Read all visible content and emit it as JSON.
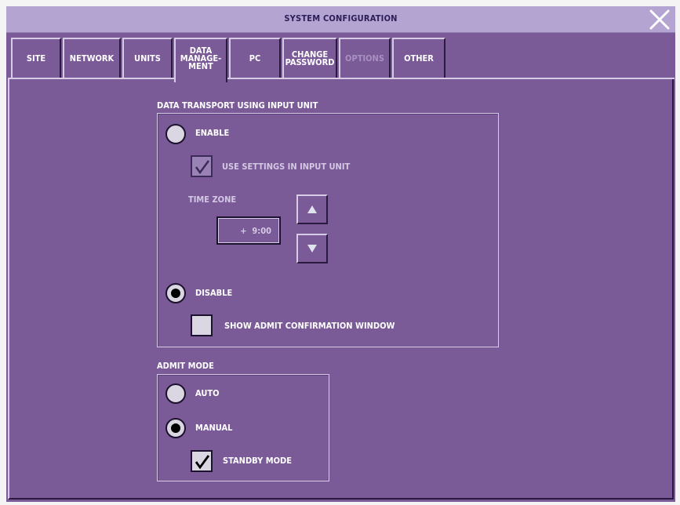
{
  "window": {
    "title": "SYSTEM CONFIGURATION"
  },
  "tabs": [
    {
      "label": [
        "SITE"
      ]
    },
    {
      "label": [
        "NETWORK"
      ]
    },
    {
      "label": [
        "UNITS"
      ]
    },
    {
      "label": [
        "DATA",
        "MANAGE-",
        "MENT"
      ],
      "active": true
    },
    {
      "label": [
        "PC"
      ]
    },
    {
      "label": [
        "CHANGE",
        "PASSWORD"
      ]
    },
    {
      "label": [
        "OPTIONS"
      ],
      "disabled": true
    },
    {
      "label": [
        "OTHER"
      ]
    }
  ],
  "tab_labels": {
    "site": "SITE",
    "network": "NETWORK",
    "units": "UNITS",
    "data_1": "DATA",
    "data_2": "MANAGE-",
    "data_3": "MENT",
    "pc": "PC",
    "change_1": "CHANGE",
    "change_2": "PASSWORD",
    "options": "OPTIONS",
    "other": "OTHER"
  },
  "data_transport": {
    "label": "DATA TRANSPORT USING INPUT UNIT",
    "enable_label": "ENABLE",
    "enable_selected": false,
    "use_settings_label": "USE SETTINGS IN INPUT UNIT",
    "use_settings_checked": true,
    "time_zone_label": "TIME ZONE",
    "time_zone_value": "+  9:00",
    "disable_label": "DISABLE",
    "disable_selected": true,
    "show_admit_label": "SHOW ADMIT CONFIRMATION WINDOW",
    "show_admit_checked": false
  },
  "admit_mode": {
    "label": "ADMIT MODE",
    "auto_label": "AUTO",
    "auto_selected": false,
    "manual_label": "MANUAL",
    "manual_selected": true,
    "standby_label": "STANDBY MODE",
    "standby_checked": true
  },
  "colors": {
    "background": "#7a5a97",
    "titlebar": "#b4a4d2",
    "title_text": "#2b1e56",
    "text": "#ffffff"
  }
}
